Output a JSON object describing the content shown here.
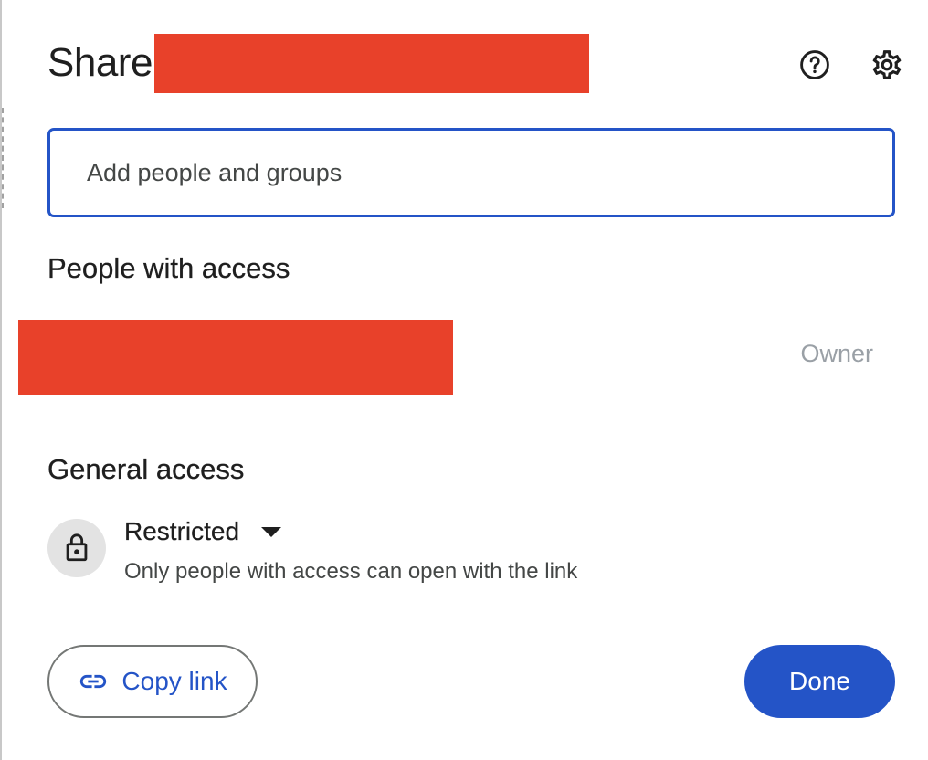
{
  "dialog": {
    "title": "Share",
    "help_icon": "help-circle-icon",
    "settings_icon": "gear-icon"
  },
  "people_input": {
    "placeholder": "Add people and groups",
    "value": ""
  },
  "people_with_access": {
    "heading": "People with access",
    "entries": [
      {
        "role": "Owner"
      }
    ]
  },
  "general_access": {
    "heading": "General access",
    "icon": "lock-icon",
    "level": "Restricted",
    "description": "Only people with access can open with the link"
  },
  "footer": {
    "copy_link_icon": "link-icon",
    "copy_link_label": "Copy link",
    "done_label": "Done"
  },
  "colors": {
    "accent": "#2454c7",
    "redaction": "#e8412a",
    "muted_text": "#9aa0a6",
    "lock_bg": "#e3e3e3"
  }
}
